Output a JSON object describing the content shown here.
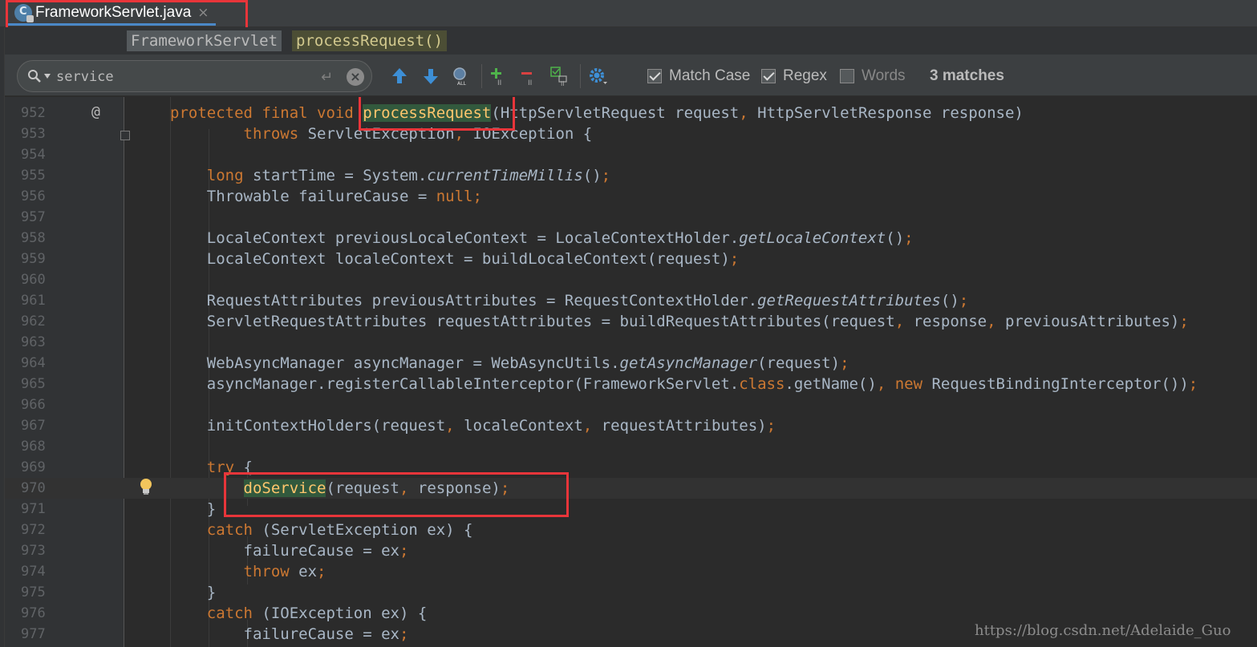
{
  "tab": {
    "title": "FrameworkServlet.java",
    "close": "×"
  },
  "breadcrumb": {
    "class_name": "FrameworkServlet",
    "method_name": "processRequest()"
  },
  "search": {
    "query": "service",
    "enter_glyph": "↵",
    "clear_glyph": "×",
    "options": [
      {
        "label": "Match Case",
        "checked": true
      },
      {
        "label": "Regex",
        "checked": true
      },
      {
        "label": "Words",
        "checked": false
      }
    ],
    "matches": "3 matches"
  },
  "editor": {
    "annotation_glyph": "@",
    "lines": [
      {
        "num": "952",
        "segs": [
          [
            "protected final void ",
            "kw"
          ],
          [
            "processRequest",
            "hitfn"
          ],
          [
            "(HttpServletRequest request",
            ""
          ],
          [
            ", ",
            "pun"
          ],
          [
            "HttpServletResponse response)",
            ""
          ]
        ]
      },
      {
        "num": "953",
        "segs": [
          [
            "        throws ",
            "kw"
          ],
          [
            "ServletException",
            ""
          ],
          [
            ", ",
            "pun"
          ],
          [
            "IOException {",
            ""
          ]
        ]
      },
      {
        "num": "954",
        "segs": []
      },
      {
        "num": "955",
        "segs": [
          [
            "    long ",
            "kw"
          ],
          [
            "startTime = System.",
            ""
          ],
          [
            "currentTimeMillis",
            "it"
          ],
          [
            "()",
            ""
          ],
          [
            ";",
            "pun"
          ]
        ]
      },
      {
        "num": "956",
        "segs": [
          [
            "    Throwable failureCause = ",
            ""
          ],
          [
            "null",
            "kw"
          ],
          [
            ";",
            "pun"
          ]
        ]
      },
      {
        "num": "957",
        "segs": []
      },
      {
        "num": "958",
        "segs": [
          [
            "    LocaleContext previousLocaleContext = LocaleContextHolder.",
            ""
          ],
          [
            "getLocaleContext",
            "it"
          ],
          [
            "()",
            ""
          ],
          [
            ";",
            "pun"
          ]
        ]
      },
      {
        "num": "959",
        "segs": [
          [
            "    LocaleContext localeContext = buildLocaleContext(request)",
            ""
          ],
          [
            ";",
            "pun"
          ]
        ]
      },
      {
        "num": "960",
        "segs": []
      },
      {
        "num": "961",
        "segs": [
          [
            "    RequestAttributes previousAttributes = RequestContextHolder.",
            ""
          ],
          [
            "getRequestAttributes",
            "it"
          ],
          [
            "()",
            ""
          ],
          [
            ";",
            "pun"
          ]
        ]
      },
      {
        "num": "962",
        "segs": [
          [
            "    ServletRequestAttributes requestAttributes = buildRequestAttributes(request",
            ""
          ],
          [
            ", ",
            "pun"
          ],
          [
            "response",
            ""
          ],
          [
            ", ",
            "pun"
          ],
          [
            "previousAttributes)",
            ""
          ],
          [
            ";",
            "pun"
          ]
        ]
      },
      {
        "num": "963",
        "segs": []
      },
      {
        "num": "964",
        "segs": [
          [
            "    WebAsyncManager asyncManager = WebAsyncUtils.",
            ""
          ],
          [
            "getAsyncManager",
            "it"
          ],
          [
            "(request)",
            ""
          ],
          [
            ";",
            "pun"
          ]
        ]
      },
      {
        "num": "965",
        "segs": [
          [
            "    asyncManager.registerCallableInterceptor(FrameworkServlet.",
            ""
          ],
          [
            "class",
            "kw"
          ],
          [
            ".getName()",
            ""
          ],
          [
            ", ",
            "pun"
          ],
          [
            "new ",
            "kw"
          ],
          [
            "RequestBindingInterceptor())",
            ""
          ],
          [
            ";",
            "pun"
          ]
        ]
      },
      {
        "num": "966",
        "segs": []
      },
      {
        "num": "967",
        "segs": [
          [
            "    initContextHolders(request",
            ""
          ],
          [
            ", ",
            "pun"
          ],
          [
            "localeContext",
            ""
          ],
          [
            ", ",
            "pun"
          ],
          [
            "requestAttributes)",
            ""
          ],
          [
            ";",
            "pun"
          ]
        ]
      },
      {
        "num": "968",
        "segs": []
      },
      {
        "num": "969",
        "segs": [
          [
            "    try ",
            "kw"
          ],
          [
            "{",
            ""
          ]
        ]
      },
      {
        "num": "970",
        "segs": [
          [
            "        ",
            ""
          ],
          [
            "doService",
            "hit"
          ],
          [
            "(request",
            ""
          ],
          [
            ", ",
            "pun"
          ],
          [
            "response)",
            ""
          ],
          [
            ";",
            "pun"
          ]
        ]
      },
      {
        "num": "971",
        "segs": [
          [
            "    }",
            ""
          ]
        ]
      },
      {
        "num": "972",
        "segs": [
          [
            "    catch ",
            "kw"
          ],
          [
            "(ServletException ex) {",
            ""
          ]
        ]
      },
      {
        "num": "973",
        "segs": [
          [
            "        failureCause = ex",
            ""
          ],
          [
            ";",
            "pun"
          ]
        ]
      },
      {
        "num": "974",
        "segs": [
          [
            "        throw ",
            "kw"
          ],
          [
            "ex",
            ""
          ],
          [
            ";",
            "pun"
          ]
        ]
      },
      {
        "num": "975",
        "segs": [
          [
            "    }",
            ""
          ]
        ]
      },
      {
        "num": "976",
        "segs": [
          [
            "    catch ",
            "kw"
          ],
          [
            "(IOException ex) {",
            ""
          ]
        ]
      },
      {
        "num": "977",
        "segs": [
          [
            "        failureCause = ex",
            ""
          ],
          [
            ";",
            "pun"
          ]
        ]
      }
    ]
  },
  "watermark": "https://blog.csdn.net/Adelaide_Guo",
  "colors": {
    "keyword": "#cc7832",
    "function": "#ffc66d",
    "text": "#a9b7c6",
    "highlight_box": "#e8353a",
    "search_hit": "#32593d"
  }
}
